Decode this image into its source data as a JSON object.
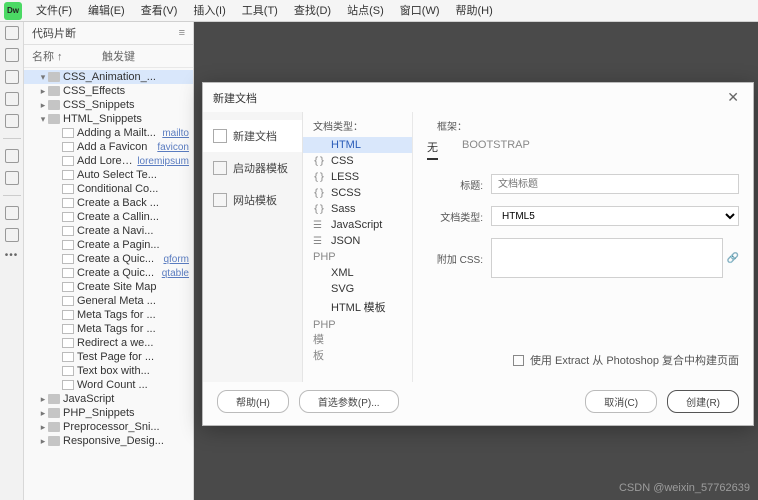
{
  "menubar": [
    "文件(F)",
    "编辑(E)",
    "查看(V)",
    "插入(I)",
    "工具(T)",
    "查找(D)",
    "站点(S)",
    "窗口(W)",
    "帮助(H)"
  ],
  "logo_text": "Dw",
  "panel": {
    "tab": "代码片断",
    "col1": "名称 ↑",
    "col2": "触发键"
  },
  "tree": [
    {
      "lvl": 1,
      "kind": "folder",
      "twist": "▾",
      "label": "CSS_Animation_...",
      "sel": true
    },
    {
      "lvl": 1,
      "kind": "folder",
      "twist": "▸",
      "label": "CSS_Effects"
    },
    {
      "lvl": 1,
      "kind": "folder",
      "twist": "▸",
      "label": "CSS_Snippets"
    },
    {
      "lvl": 1,
      "kind": "folder",
      "twist": "▾",
      "label": "HTML_Snippets"
    },
    {
      "lvl": 2,
      "kind": "file",
      "label": "Adding a Mailt...",
      "link": "mailto"
    },
    {
      "lvl": 2,
      "kind": "file",
      "label": "Add a Favicon",
      "link": "favicon"
    },
    {
      "lvl": 2,
      "kind": "file",
      "label": "Add Loreum I...",
      "link": "loremipsum"
    },
    {
      "lvl": 2,
      "kind": "file",
      "label": "Auto Select Te..."
    },
    {
      "lvl": 2,
      "kind": "file",
      "label": "Conditional Co..."
    },
    {
      "lvl": 2,
      "kind": "file",
      "label": "Create a Back ..."
    },
    {
      "lvl": 2,
      "kind": "file",
      "label": "Create a Callin..."
    },
    {
      "lvl": 2,
      "kind": "file",
      "label": "Create a Navi..."
    },
    {
      "lvl": 2,
      "kind": "file",
      "label": "Create a Pagin..."
    },
    {
      "lvl": 2,
      "kind": "file",
      "label": "Create a Quic...",
      "link": "qform"
    },
    {
      "lvl": 2,
      "kind": "file",
      "label": "Create a Quic...",
      "link": "qtable"
    },
    {
      "lvl": 2,
      "kind": "file",
      "label": "Create Site Map"
    },
    {
      "lvl": 2,
      "kind": "file",
      "label": "General Meta ..."
    },
    {
      "lvl": 2,
      "kind": "file",
      "label": "Meta Tags for ..."
    },
    {
      "lvl": 2,
      "kind": "file",
      "label": "Meta Tags for ..."
    },
    {
      "lvl": 2,
      "kind": "file",
      "label": "Redirect a we..."
    },
    {
      "lvl": 2,
      "kind": "file",
      "label": "Test Page for ..."
    },
    {
      "lvl": 2,
      "kind": "file",
      "label": "Text box with..."
    },
    {
      "lvl": 2,
      "kind": "file",
      "label": "Word Count ..."
    },
    {
      "lvl": 1,
      "kind": "folder",
      "twist": "▸",
      "label": "JavaScript"
    },
    {
      "lvl": 1,
      "kind": "folder",
      "twist": "▸",
      "label": "PHP_Snippets"
    },
    {
      "lvl": 1,
      "kind": "folder",
      "twist": "▸",
      "label": "Preprocessor_Sni..."
    },
    {
      "lvl": 1,
      "kind": "folder",
      "twist": "▸",
      "label": "Responsive_Desig..."
    }
  ],
  "dialog": {
    "title": "新建文档",
    "cats": [
      "新建文档",
      "启动器模板",
      "网站模板"
    ],
    "doctype_header": "文档类型：",
    "doctypes": [
      {
        "icon": "</>",
        "label": "HTML",
        "sel": true
      },
      {
        "icon": "{}",
        "label": "CSS"
      },
      {
        "icon": "{}",
        "label": "LESS"
      },
      {
        "icon": "{}",
        "label": "SCSS"
      },
      {
        "icon": "{}",
        "label": "Sass"
      },
      {
        "icon": "☰",
        "label": "JavaScript"
      },
      {
        "icon": "☰",
        "label": "JSON"
      },
      {
        "icon": "<?",
        "label": "PHP"
      },
      {
        "icon": "</>",
        "label": "XML"
      },
      {
        "icon": "</>",
        "label": "SVG"
      },
      {
        "icon": "</>",
        "label": "HTML 模板"
      },
      {
        "icon": "<?",
        "label": "PHP 模板"
      }
    ],
    "framework_label": "框架：",
    "frameworks": [
      "无",
      "BOOTSTRAP"
    ],
    "form": {
      "title_lbl": "标题:",
      "title_ph": "文档标题",
      "dtype_lbl": "文档类型:",
      "dtype_val": "HTML5",
      "css_lbl": "附加 CSS:"
    },
    "extract": "使用 Extract 从 Photoshop 复合中构建页面",
    "buttons": {
      "help": "帮助(H)",
      "prefs": "首选参数(P)...",
      "cancel": "取消(C)",
      "create": "创建(R)"
    }
  },
  "watermark": "CSDN @weixin_57762639"
}
